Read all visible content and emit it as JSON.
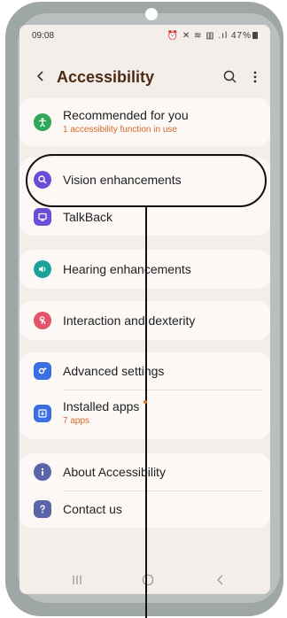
{
  "status_bar": {
    "time": "09:08",
    "icons": "⏰ ✕ ≋ ▥ .ıl 47%"
  },
  "header": {
    "title": "Accessibility"
  },
  "items": [
    {
      "label": "Recommended for you",
      "subtitle": "1 accessibility function in use",
      "icon": "accessibility-person-icon",
      "color": "#2fa956"
    },
    {
      "label": "Vision enhancements",
      "icon": "magnifier-icon",
      "color": "#6a4fd6"
    },
    {
      "label": "TalkBack",
      "icon": "talkback-screen-icon",
      "color": "#6a4fd6"
    },
    {
      "label": "Hearing enhancements",
      "icon": "speaker-icon",
      "color": "#1aa39b"
    },
    {
      "label": "Interaction and dexterity",
      "icon": "touch-hand-icon",
      "color": "#e2556a"
    },
    {
      "label": "Advanced settings",
      "icon": "gear-plus-icon",
      "color": "#3b6fe0"
    },
    {
      "label": "Installed apps",
      "subtitle": "7 apps",
      "icon": "download-box-icon",
      "color": "#3b6fe0"
    },
    {
      "label": "About Accessibility",
      "icon": "info-icon",
      "color": "#5c64a8"
    },
    {
      "label": "Contact us",
      "icon": "question-icon",
      "color": "#5c64a8"
    }
  ],
  "colors": {
    "accent": "#d9682a",
    "title": "#4c2a15",
    "background": "#f3eeea",
    "card": "#fbf8f6"
  }
}
